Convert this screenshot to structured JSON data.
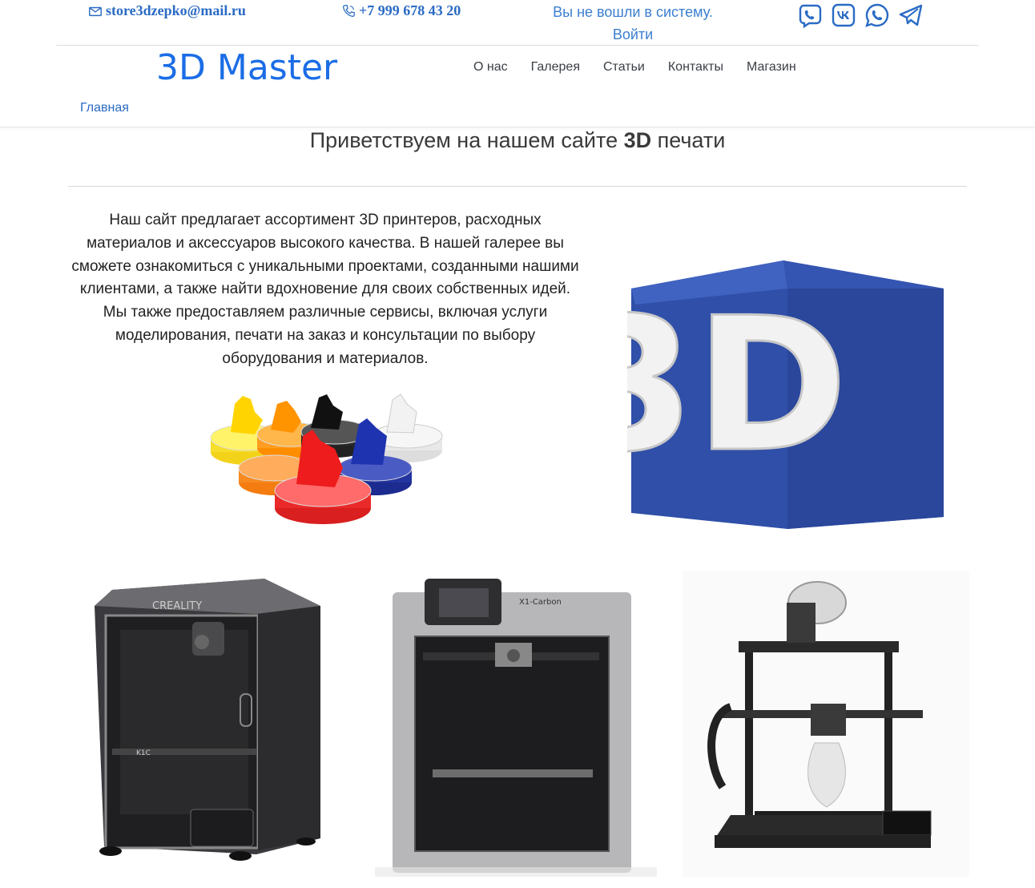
{
  "contacts": {
    "email": "store3dzepko@mail.ru",
    "phone": "+7 999 678 43 20"
  },
  "auth": {
    "status": "Вы не вошли в систему.",
    "login": "Войти"
  },
  "socials": [
    "viber-icon",
    "vk-icon",
    "whatsapp-icon",
    "telegram-icon"
  ],
  "brand": "3D Master",
  "nav": {
    "items": [
      "О нас",
      "Галерея",
      "Статьи",
      "Контакты",
      "Магазин"
    ],
    "home": "Главная"
  },
  "welcome": {
    "prefix": "Приветствуем на нашем сайте ",
    "highlight": "3D",
    "suffix": " печати"
  },
  "intro": "Наш сайт предлагает ассортимент 3D принтеров, расходных материалов и аксессуаров высокого качества. В нашей галерее вы сможете ознакомиться с уникальными проектами, созданными нашими клиентами, а также найти вдохновение для своих собственных идей. Мы также предоставляем различные сервисы, включая услуги моделирования, печати на заказ и консультации по выбору оборудования и материалов.",
  "images": {
    "cube_text": "3D",
    "printer1_brand": "CREALITY",
    "printer1_model": "K1C",
    "printer2_model": "X1-Carbon"
  },
  "colors": {
    "brand": "#1b6de6",
    "link": "#2a6bc4",
    "cube": "#2f4fa8"
  }
}
